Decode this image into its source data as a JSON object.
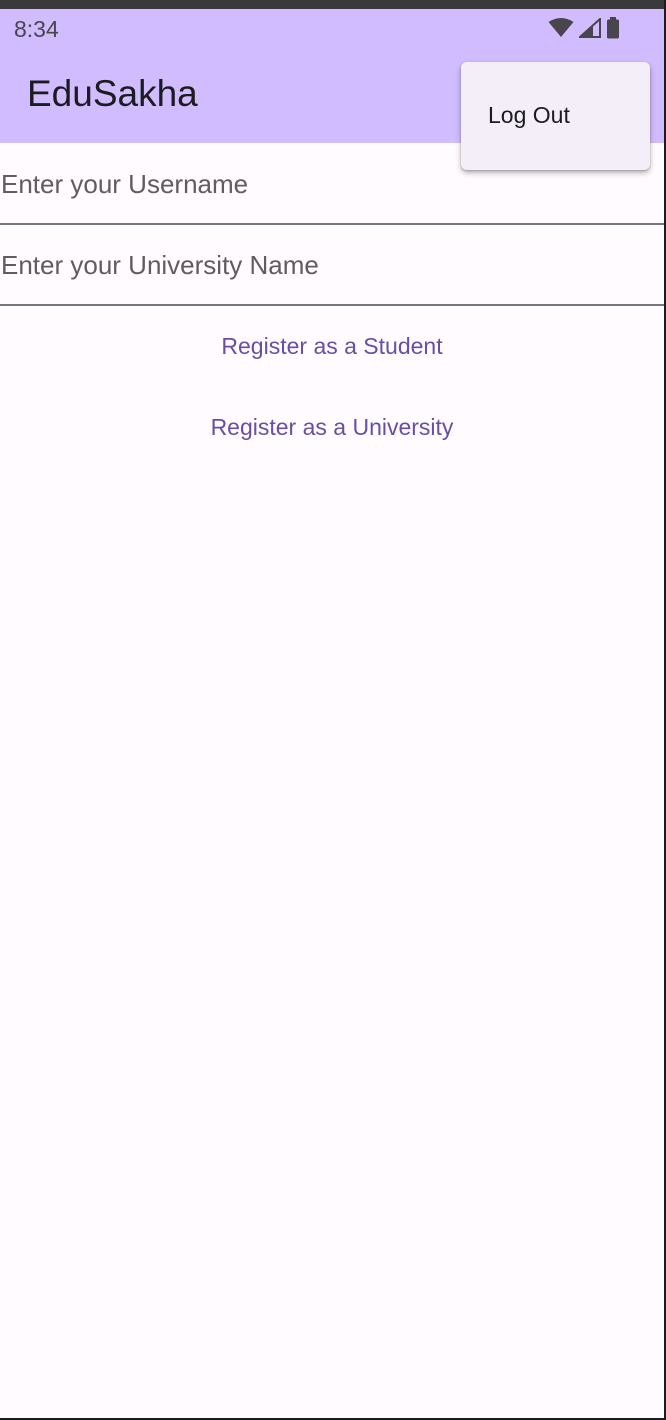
{
  "status_bar": {
    "time": "8:34",
    "icons": [
      "wifi-icon",
      "cellular-signal-icon",
      "battery-icon"
    ],
    "background": "#d0bcff"
  },
  "app_bar": {
    "title": "EduSakha",
    "background": "#d0bcff"
  },
  "overflow_menu": {
    "items": [
      {
        "label": "Log Out"
      }
    ]
  },
  "form": {
    "username_placeholder": "Enter your Username",
    "username_value": "",
    "university_placeholder": "Enter your University Name",
    "university_value": ""
  },
  "actions": {
    "register_student": "Register as a Student",
    "register_university": "Register as a University"
  },
  "colors": {
    "primary": "#6750a4",
    "surface": "#fffbfe",
    "menu_surface": "#f3eef8"
  }
}
